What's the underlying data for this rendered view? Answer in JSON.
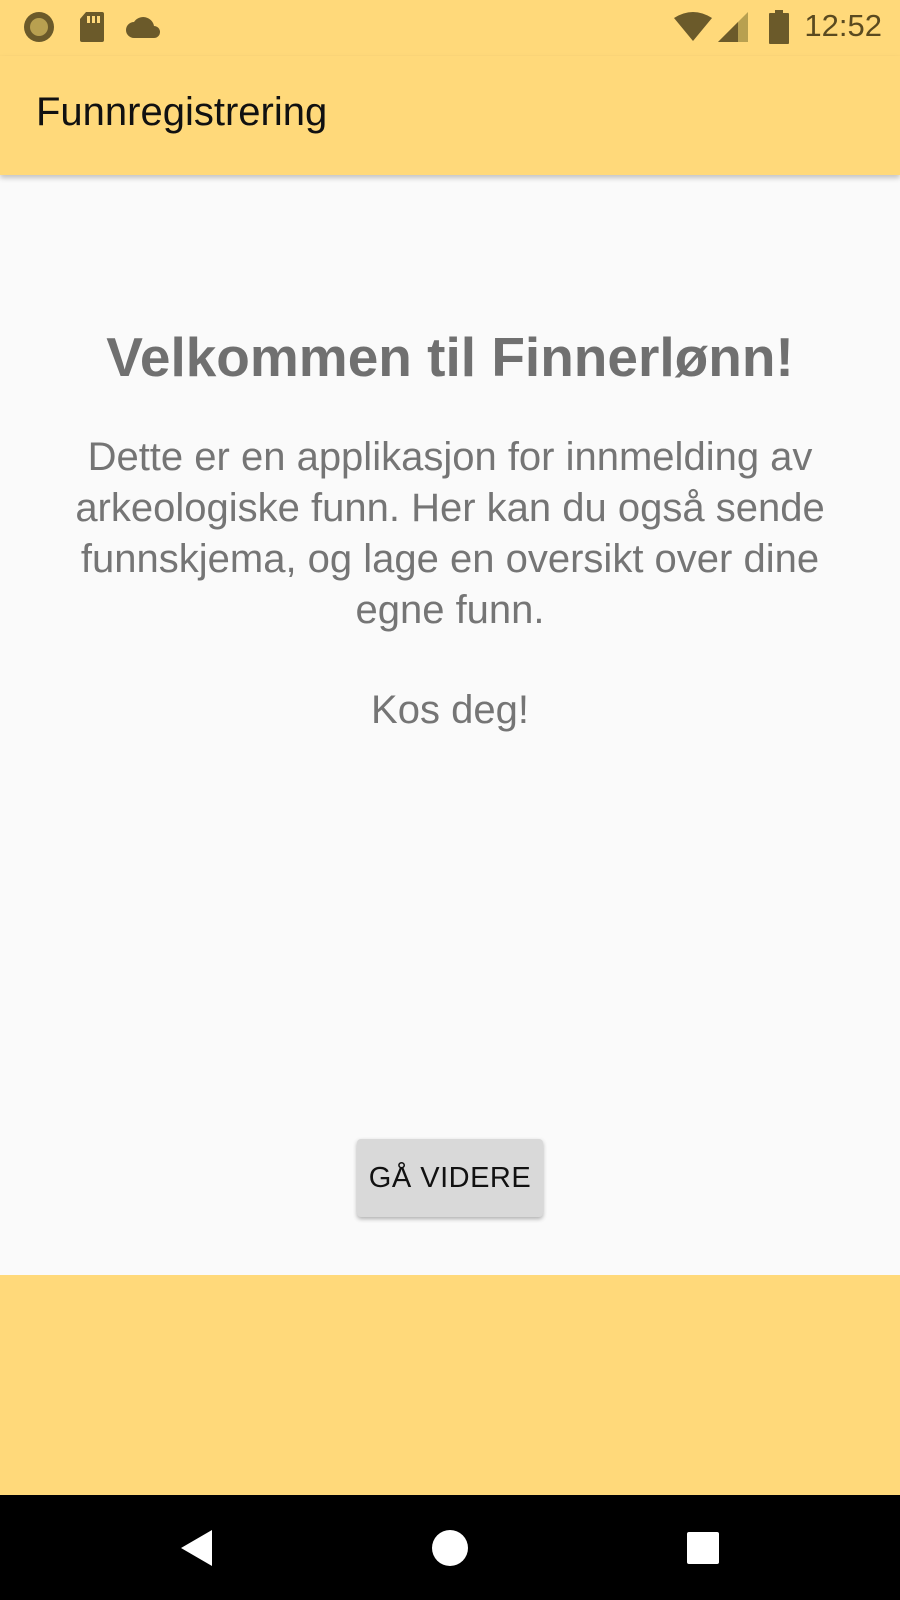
{
  "status_bar": {
    "time": "12:52",
    "icons": [
      "circle-notification-icon",
      "sd-card-icon",
      "cloud-icon",
      "wifi-icon",
      "cell-signal-icon",
      "battery-icon"
    ]
  },
  "app_bar": {
    "title": "Funnregistrering"
  },
  "main": {
    "heading": "Velkommen til Finnerlønn!",
    "body": "Dette er en applikasjon for innmelding av arkeologiske funn. Her kan du også sende funnskjema, og lage en oversikt over dine egne funn.",
    "closing": "Kos deg!",
    "continue_label": "GÅ VIDERE"
  },
  "navigation": {
    "icons": [
      "back-icon",
      "home-icon",
      "recents-icon"
    ]
  },
  "colors": {
    "accent": "#ffd97a",
    "background": "#fafafa",
    "text_muted": "#757575",
    "button_bg": "#d9d9d9"
  }
}
